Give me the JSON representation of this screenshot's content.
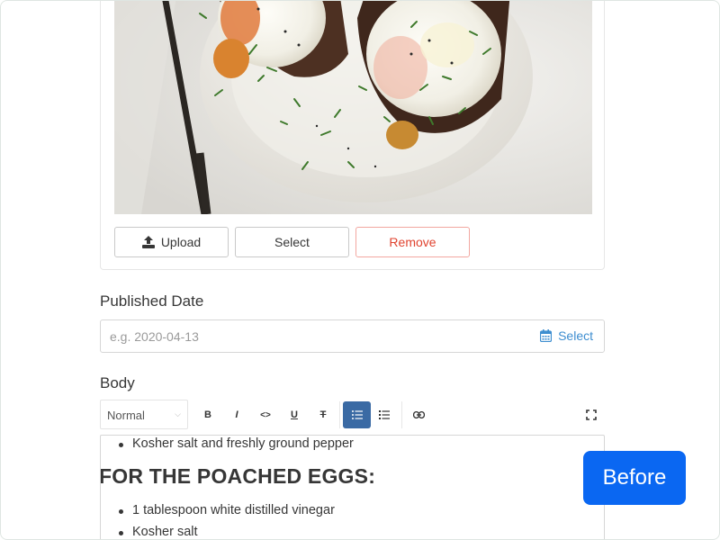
{
  "image_card": {
    "photo_alt": "poached eggs on toast",
    "buttons": {
      "upload_label": "Upload",
      "select_label": "Select",
      "remove_label": "Remove"
    }
  },
  "published_date": {
    "label": "Published Date",
    "placeholder": "e.g. 2020-04-13",
    "select_label": "Select"
  },
  "body": {
    "label": "Body",
    "toolbar": {
      "format_value": "Normal",
      "buttons": [
        "bold-icon",
        "italic-icon",
        "code-icon",
        "underline-icon",
        "strikethrough-icon",
        "bullet-list-icon",
        "ordered-list-icon",
        "link-icon",
        "fullscreen-icon"
      ],
      "active": "bullet-list-icon",
      "bold_glyph": "B",
      "italic_glyph": "I",
      "code_glyph": "<>",
      "underline_glyph": "U",
      "strike_glyph": "T"
    },
    "content": {
      "item_1": "Kosher salt and freshly ground pepper",
      "heading": "FOR THE POACHED EGGS:",
      "item_2": "1 tablespoon white distilled vinegar",
      "item_3": "Kosher salt"
    }
  },
  "badge": {
    "label": "Before"
  },
  "colors": {
    "accent_blue": "#3e8ed0",
    "remove_red": "#e0432f",
    "toolbar_active": "#3a6aa4",
    "badge_blue": "#0a67f2"
  }
}
